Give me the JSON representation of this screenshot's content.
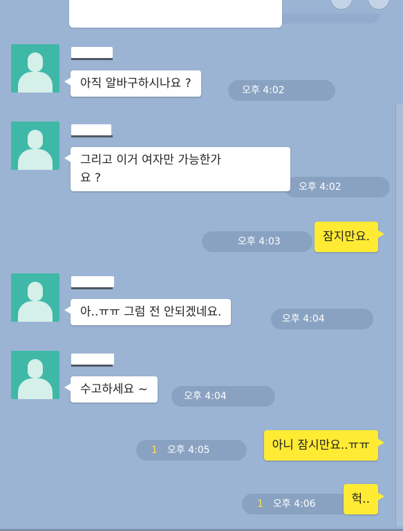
{
  "colors": {
    "background": "#9bb4d4",
    "incoming_bubble": "#ffffff",
    "outgoing_bubble": "#ffeb33",
    "avatar": "#3fb8a8",
    "time_pill": "#8aa2c2",
    "unread_count": "#ffe14d"
  },
  "messages": [
    {
      "direction": "in",
      "text": "아직 알바구하시나요 ?",
      "time": "오후 4:02"
    },
    {
      "direction": "in",
      "text": "그리고 이거 여자만 가능한가\n요 ?",
      "time": "오후 4:02"
    },
    {
      "direction": "out",
      "text": "잠지만요.",
      "time": "오후 4:03"
    },
    {
      "direction": "in",
      "text": "아..ㅠㅠ 그럼 전 안되겠네요.",
      "time": "오후 4:04"
    },
    {
      "direction": "in",
      "text": "수고하세요 ~",
      "time": "오후 4:04"
    },
    {
      "direction": "out",
      "text": "아니 잠시만요..ㅠㅠ",
      "time": "오후 4:05",
      "unread": "1"
    },
    {
      "direction": "out",
      "text": "헉..",
      "time": "오후 4:06",
      "unread": "1"
    }
  ]
}
